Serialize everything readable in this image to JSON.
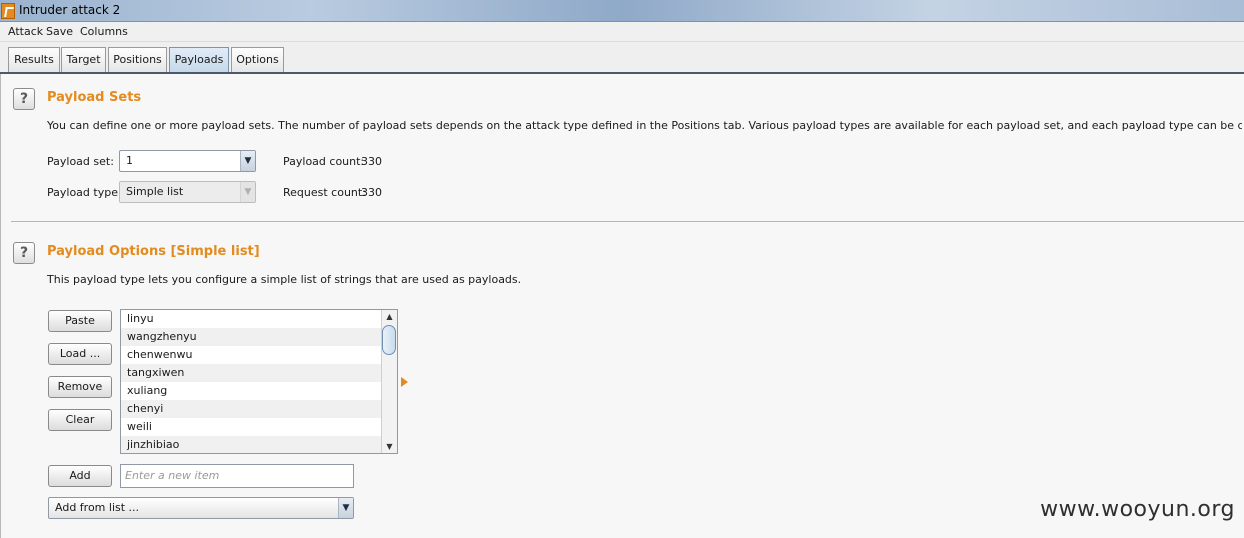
{
  "window": {
    "title": "Intruder attack 2"
  },
  "menu": [
    "Attack",
    "Save",
    "Columns"
  ],
  "tabs": [
    {
      "label": "Results"
    },
    {
      "label": "Target"
    },
    {
      "label": "Positions"
    },
    {
      "label": "Payloads",
      "active": true
    },
    {
      "label": "Options"
    }
  ],
  "payload_sets": {
    "title": "Payload Sets",
    "description": "You can define one or more payload sets. The number of payload sets depends on the attack type defined in the Positions tab. Various payload types are available for each payload set, and each payload type can be customized in different ways.",
    "set_label": "Payload set:",
    "set_value": "1",
    "type_label": "Payload type:",
    "type_value": "Simple list",
    "count_label": "Payload count:",
    "count_value": "330",
    "request_label": "Request count:",
    "request_value": "330"
  },
  "payload_options": {
    "title": "Payload Options [Simple list]",
    "description": "This payload type lets you configure a simple list of strings that are used as payloads.",
    "buttons": {
      "paste": "Paste",
      "load": "Load ...",
      "remove": "Remove",
      "clear": "Clear",
      "add": "Add"
    },
    "items": [
      "linyu",
      "wangzhenyu",
      "chenwenwu",
      "tangxiwen",
      "xuliang",
      "chenyi",
      "weili",
      "jinzhibiao"
    ],
    "new_item_placeholder": "Enter a new item",
    "add_from_list": "Add from list ..."
  },
  "watermark": "www.wooyun.org",
  "colors": {
    "accent": "#e38b1e",
    "tab_active": "#c6d8ea"
  },
  "icons": {
    "help": "?",
    "dropdown": "▼",
    "scroll_up": "▲",
    "scroll_down": "▼"
  }
}
